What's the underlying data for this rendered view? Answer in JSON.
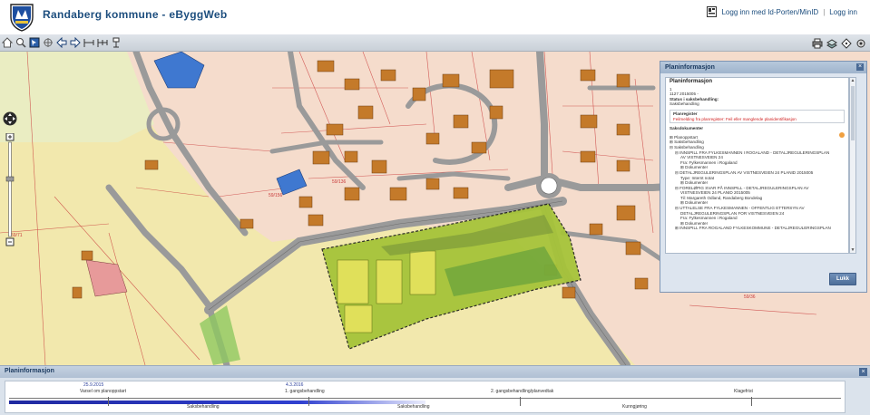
{
  "header": {
    "app_title": "Randaberg kommune - eByggWeb",
    "login_idporten": "Logg inn med Id-Porten/MinID",
    "login_separator": "|",
    "login": "Logg inn"
  },
  "toolbar": {
    "left_icons": [
      "home-icon",
      "zoom-icon",
      "select-icon",
      "measure-icon",
      "back-arrow-icon",
      "forward-arrow-icon",
      "ruler-icon",
      "pan-icon",
      "info-icon"
    ],
    "right_icons": [
      "print-icon",
      "layers-icon",
      "help-icon",
      "settings-icon"
    ]
  },
  "map": {
    "parcel_labels": [
      "59/71",
      "59/136",
      "59/156",
      "59/36"
    ],
    "colors": {
      "agriculture": "#f2e8ad",
      "residential": "#f5dccc",
      "road": "#9a9a9a",
      "building": "#c47a2a",
      "plan_area": "#a6c43a",
      "blue_building": "#3f78d0"
    }
  },
  "plan_panel": {
    "title": "Planinformasjon",
    "heading": "Planinformasjon",
    "case_number_prefix": "1",
    "case_number": "1127 2015005 -",
    "status_label": "Status i saksbehandling:",
    "status_value": "Saksbehandling",
    "plan_register_label": "Planregister",
    "plan_register_error": "Feilmelding fra planregister: Feil eller manglende planidentifikasjon",
    "docs_label": "Saksdokumenter",
    "tree": [
      {
        "level": 1,
        "text": "⊞ Planoppstart"
      },
      {
        "level": 1,
        "text": "⊞ Saksbehandling"
      },
      {
        "level": 1,
        "text": "⊟ Saksbehandling"
      },
      {
        "level": 2,
        "text": "⊟ INNSPILL FRA FYLKESMANNEN I ROGALAND - DETALJREGULERINGSPLAN"
      },
      {
        "level": 3,
        "text": "AV VISTNESVEIEN 24"
      },
      {
        "level": 3,
        "text": "Fra: Fylkesmannen i Rogaland"
      },
      {
        "level": 3,
        "text": "⊞ Dokumenter"
      },
      {
        "level": 2,
        "text": "⊟ DETALJREGULERINGSPLAN AV VISTNESVEIEN 24 PLANID 2015005"
      },
      {
        "level": 3,
        "text": "Type: Internt notat"
      },
      {
        "level": 3,
        "text": "⊞ Dokumenter"
      },
      {
        "level": 2,
        "text": "⊟ FORELØPIG SVAR PÅ INNSPILL - DETALJREGULERINGSPLAN AV"
      },
      {
        "level": 3,
        "text": "VISTNESVEIEN 24 PLANID 2015005"
      },
      {
        "level": 3,
        "text": "Til: Margareth Odland, Randaberg Bondelag"
      },
      {
        "level": 3,
        "text": "⊞ Dokumenter"
      },
      {
        "level": 2,
        "text": "⊟ UTTALELSE FRA FYLKESMANNEN - OFFENTLIG ETTERSYN AV"
      },
      {
        "level": 3,
        "text": "DETALJREGULERINGSPLAN FOR VISTNESVEIEN 24"
      },
      {
        "level": 3,
        "text": "Fra: Fylkesmannen i Rogaland"
      },
      {
        "level": 3,
        "text": "⊞ Dokumenter"
      },
      {
        "level": 2,
        "text": "⊞ INNSPILL FRA ROGALAND FYLKESKOMMUNE - DETALJREGULERINGSPLAN"
      }
    ],
    "close_button": "Lukk",
    "close_x": "×"
  },
  "timeline": {
    "title": "Planinformasjon",
    "close_x": "×",
    "dates": [
      "25.9.2015",
      "4.3.2016"
    ],
    "top_labels": [
      "Varsel om planoppstart",
      "1. gangsbehandling",
      "2. gangsbehandling/planvedtak",
      "Klagefrist"
    ],
    "bottom_labels": [
      "Saksbehandling",
      "Saksbehandling",
      "Kunngjøring"
    ],
    "progress": 0.5
  }
}
